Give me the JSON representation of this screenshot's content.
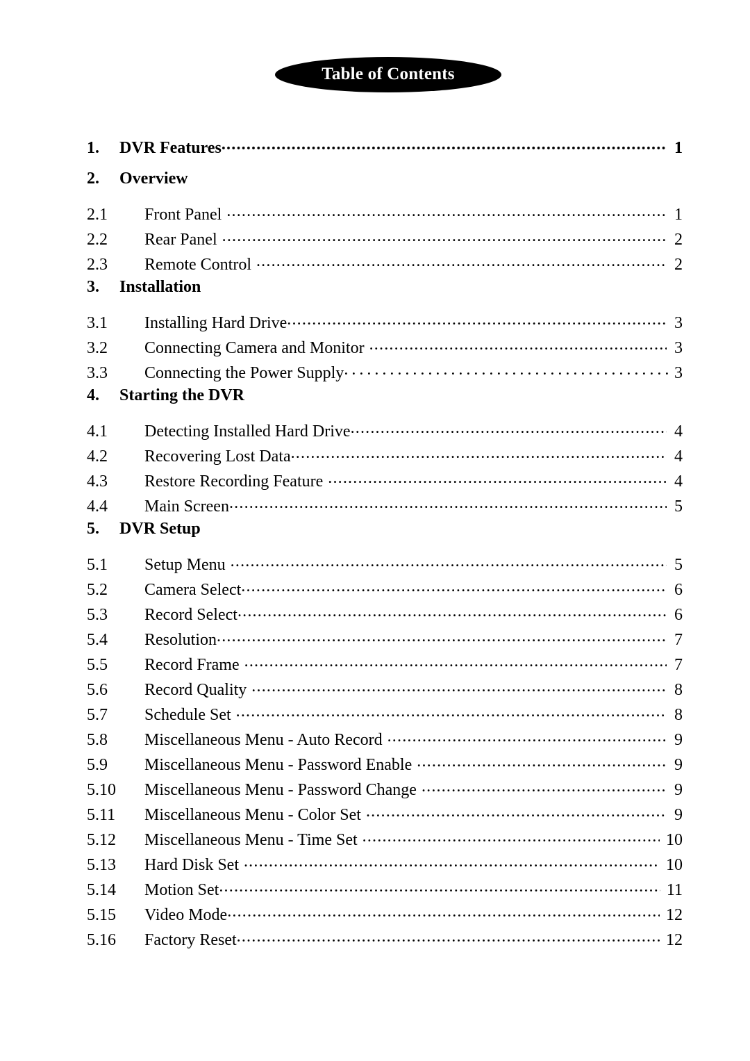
{
  "document": {
    "header": {
      "title": "Table of Contents",
      "shape": "ellipse",
      "background_color": "#000000",
      "text_color": "#ffffff"
    },
    "page_background": "#ffffff",
    "text_color": "#000000"
  },
  "toc": {
    "entries": [
      {
        "number": "1.",
        "title": "DVR Features",
        "page": "1",
        "level": 1,
        "leader": "dots",
        "gap": false
      },
      {
        "number": "2.",
        "title": "Overview",
        "page": "",
        "level": 1,
        "leader": "none",
        "gap": false
      },
      {
        "number": "2.1",
        "title": "Front Panel",
        "page": "1",
        "level": 2,
        "leader": "dots",
        "gap": true
      },
      {
        "number": "2.2",
        "title": "Rear Panel",
        "page": "2",
        "level": 2,
        "leader": "dots",
        "gap": true
      },
      {
        "number": "2.3",
        "title": "Remote Control",
        "page": "2",
        "level": 2,
        "leader": "dots",
        "gap": true
      },
      {
        "number": "3.",
        "title": "Installation",
        "page": "",
        "level": 1,
        "leader": "none",
        "gap": false
      },
      {
        "number": "3.1",
        "title": "Installing Hard Drive",
        "page": "3",
        "level": 2,
        "leader": "dots",
        "gap": false
      },
      {
        "number": "3.2",
        "title": "Connecting Camera and Monitor",
        "page": "3",
        "level": 2,
        "leader": "dots",
        "gap": true
      },
      {
        "number": "3.3",
        "title": "Connecting the Power Supply",
        "page": "3",
        "level": 2,
        "leader": "wide",
        "gap": false
      },
      {
        "number": "4.",
        "title": "Starting the DVR",
        "page": "",
        "level": 1,
        "leader": "none",
        "gap": false
      },
      {
        "number": "4.1",
        "title": "Detecting Installed Hard Drive",
        "page": "4",
        "level": 2,
        "leader": "dots",
        "gap": false
      },
      {
        "number": "4.2",
        "title": "Recovering Lost Data",
        "page": "4",
        "level": 2,
        "leader": "dots",
        "gap": false
      },
      {
        "number": "4.3",
        "title": "Restore Recording Feature",
        "page": "4",
        "level": 2,
        "leader": "dots",
        "gap": true
      },
      {
        "number": "4.4",
        "title": "Main Screen",
        "page": "5",
        "level": 2,
        "leader": "dots",
        "gap": false
      },
      {
        "number": "5.",
        "title": "DVR Setup",
        "page": "",
        "level": 1,
        "leader": "none",
        "gap": false
      },
      {
        "number": "5.1",
        "title": "Setup Menu",
        "page": "5",
        "level": 2,
        "leader": "dots",
        "gap": true
      },
      {
        "number": "5.2",
        "title": "Camera Select",
        "page": "6",
        "level": 2,
        "leader": "dots",
        "gap": false
      },
      {
        "number": "5.3",
        "title": "Record Select",
        "page": "6",
        "level": 2,
        "leader": "dots",
        "gap": false
      },
      {
        "number": "5.4",
        "title": "Resolution",
        "page": "7",
        "level": 2,
        "leader": "dots",
        "gap": false
      },
      {
        "number": "5.5",
        "title": "Record Frame",
        "page": "7",
        "level": 2,
        "leader": "dots",
        "gap": true
      },
      {
        "number": "5.6",
        "title": "Record Quality",
        "page": "8",
        "level": 2,
        "leader": "dots",
        "gap": true
      },
      {
        "number": "5.7",
        "title": "Schedule Set",
        "page": "8",
        "level": 2,
        "leader": "dots",
        "gap": true
      },
      {
        "number": "5.8",
        "title": "Miscellaneous Menu - Auto Record",
        "page": "9",
        "level": 2,
        "leader": "dots",
        "gap": true
      },
      {
        "number": "5.9",
        "title": "Miscellaneous Menu - Password Enable",
        "page": "9",
        "level": 2,
        "leader": "dots",
        "gap": true
      },
      {
        "number": "5.10",
        "title": "Miscellaneous Menu - Password Change",
        "page": "9",
        "level": 2,
        "leader": "dots",
        "gap": true
      },
      {
        "number": "5.11",
        "title": "Miscellaneous Menu - Color Set",
        "page": "9",
        "level": 2,
        "leader": "dots",
        "gap": true
      },
      {
        "number": "5.12",
        "title": "Miscellaneous Menu - Time Set",
        "page": "10",
        "level": 2,
        "leader": "dots",
        "gap": true
      },
      {
        "number": "5.13",
        "title": "Hard Disk Set",
        "page": "10",
        "level": 2,
        "leader": "dots",
        "gap": true
      },
      {
        "number": "5.14",
        "title": "Motion Set",
        "page": "11",
        "level": 2,
        "leader": "dots",
        "gap": false
      },
      {
        "number": "5.15",
        "title": "Video Mode",
        "page": "12",
        "level": 2,
        "leader": "dots",
        "gap": false
      },
      {
        "number": "5.16",
        "title": "Factory Reset",
        "page": "12",
        "level": 2,
        "leader": "dots",
        "gap": false
      }
    ]
  }
}
